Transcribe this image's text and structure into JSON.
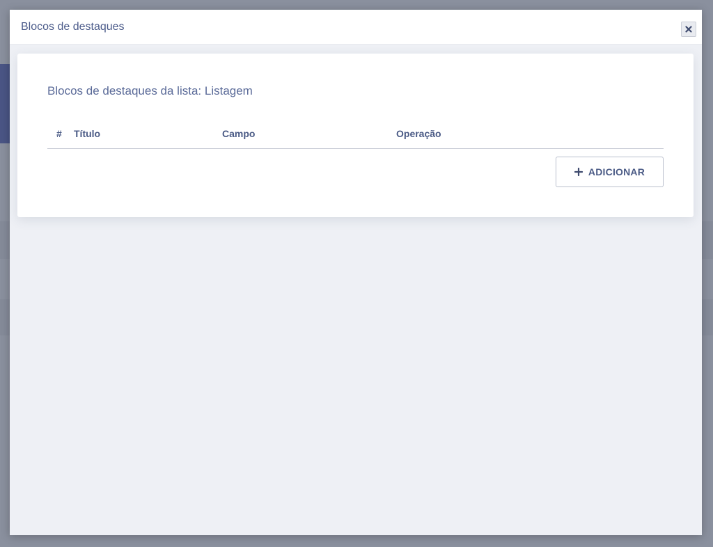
{
  "modal": {
    "title": "Blocos de destaques",
    "close_icon": "close-icon"
  },
  "card": {
    "heading": "Blocos de destaques da lista: Listagem",
    "columns": [
      "#",
      "Título",
      "Campo",
      "Operação"
    ],
    "rows": [],
    "add_button_label": "ADICIONAR",
    "add_icon": "plus-icon"
  },
  "colors": {
    "overlay": "#7a8191",
    "modal_body": "#eef0f5",
    "text_primary": "#4a5a85"
  }
}
